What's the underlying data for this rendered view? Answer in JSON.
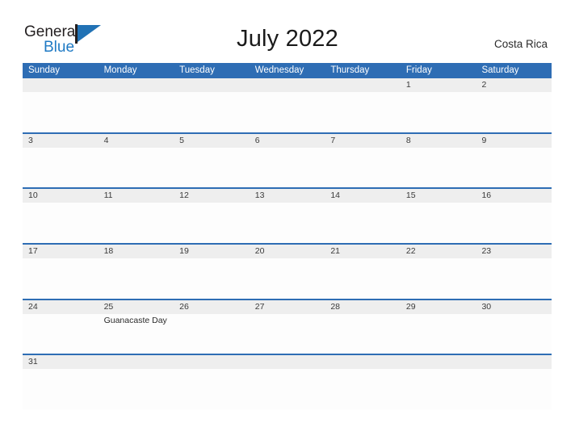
{
  "brand": {
    "name_part1": "General",
    "name_part2": "Blue",
    "mark": "blue-triangle-flag"
  },
  "header": {
    "title": "July 2022",
    "country": "Costa Rica"
  },
  "colors": {
    "header_blue": "#2e6db4",
    "row_divider_blue": "#2e6db4",
    "daynumber_strip_gray": "#eeeeee",
    "logo_blue": "#1f7ac4",
    "logo_dark": "#231f20"
  },
  "calendar": {
    "month": "July",
    "year": "2022",
    "weekdays": [
      "Sunday",
      "Monday",
      "Tuesday",
      "Wednesday",
      "Thursday",
      "Friday",
      "Saturday"
    ],
    "weeks": [
      {
        "days": [
          {
            "num": "",
            "events": []
          },
          {
            "num": "",
            "events": []
          },
          {
            "num": "",
            "events": []
          },
          {
            "num": "",
            "events": []
          },
          {
            "num": "",
            "events": []
          },
          {
            "num": "1",
            "events": []
          },
          {
            "num": "2",
            "events": []
          }
        ]
      },
      {
        "days": [
          {
            "num": "3",
            "events": []
          },
          {
            "num": "4",
            "events": []
          },
          {
            "num": "5",
            "events": []
          },
          {
            "num": "6",
            "events": []
          },
          {
            "num": "7",
            "events": []
          },
          {
            "num": "8",
            "events": []
          },
          {
            "num": "9",
            "events": []
          }
        ]
      },
      {
        "days": [
          {
            "num": "10",
            "events": []
          },
          {
            "num": "11",
            "events": []
          },
          {
            "num": "12",
            "events": []
          },
          {
            "num": "13",
            "events": []
          },
          {
            "num": "14",
            "events": []
          },
          {
            "num": "15",
            "events": []
          },
          {
            "num": "16",
            "events": []
          }
        ]
      },
      {
        "days": [
          {
            "num": "17",
            "events": []
          },
          {
            "num": "18",
            "events": []
          },
          {
            "num": "19",
            "events": []
          },
          {
            "num": "20",
            "events": []
          },
          {
            "num": "21",
            "events": []
          },
          {
            "num": "22",
            "events": []
          },
          {
            "num": "23",
            "events": []
          }
        ]
      },
      {
        "days": [
          {
            "num": "24",
            "events": []
          },
          {
            "num": "25",
            "events": [
              "Guanacaste Day"
            ]
          },
          {
            "num": "26",
            "events": []
          },
          {
            "num": "27",
            "events": []
          },
          {
            "num": "28",
            "events": []
          },
          {
            "num": "29",
            "events": []
          },
          {
            "num": "30",
            "events": []
          }
        ]
      },
      {
        "days": [
          {
            "num": "31",
            "events": []
          },
          {
            "num": "",
            "events": []
          },
          {
            "num": "",
            "events": []
          },
          {
            "num": "",
            "events": []
          },
          {
            "num": "",
            "events": []
          },
          {
            "num": "",
            "events": []
          },
          {
            "num": "",
            "events": []
          }
        ]
      }
    ]
  }
}
